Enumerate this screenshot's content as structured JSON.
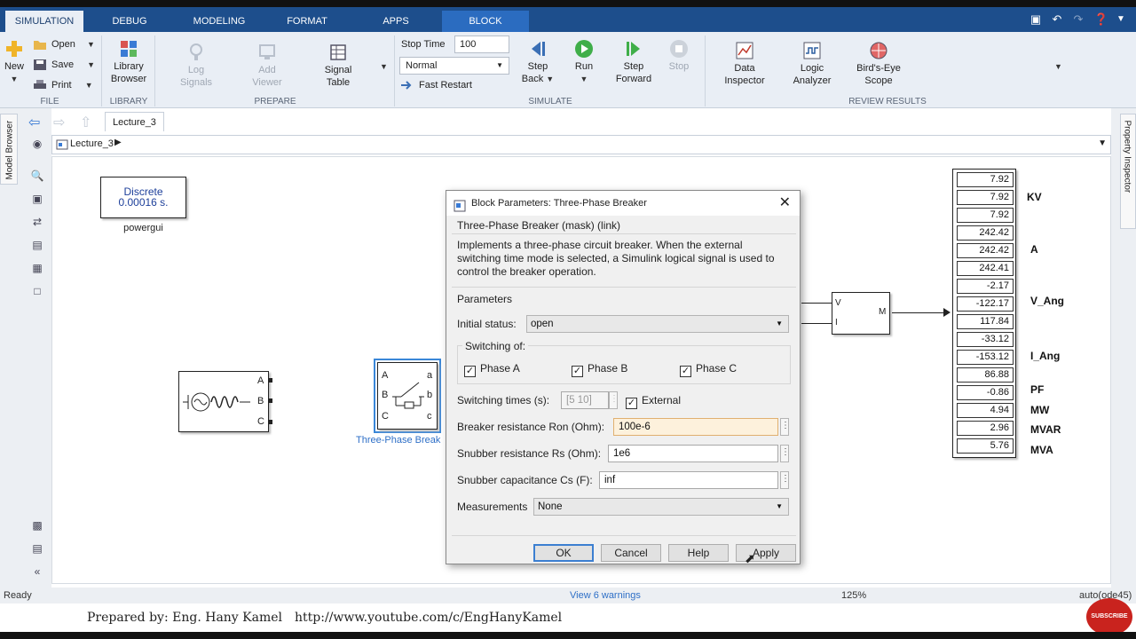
{
  "tabs": [
    {
      "label": "SIMULATION"
    },
    {
      "label": "DEBUG"
    },
    {
      "label": "MODELING"
    },
    {
      "label": "FORMAT"
    },
    {
      "label": "APPS"
    },
    {
      "label": "BLOCK"
    }
  ],
  "ribbon": {
    "file": {
      "new_label": "New",
      "open_label": "Open",
      "save_label": "Save",
      "print_label": "Print",
      "group_label": "FILE"
    },
    "library": {
      "browser_label_1": "Library",
      "browser_label_2": "Browser",
      "group_label": "LIBRARY"
    },
    "prepare": {
      "log_1": "Log",
      "log_2": "Signals",
      "add_1": "Add",
      "add_2": "Viewer",
      "signal_1": "Signal",
      "signal_2": "Table",
      "group_label": "PREPARE"
    },
    "simulate": {
      "stop_time_label": "Stop Time",
      "stop_time_value": "100",
      "mode_value": "Normal",
      "fast_restart_label": "Fast Restart",
      "step_back_1": "Step",
      "step_back_2": "Back",
      "run_label": "Run",
      "step_fwd_1": "Step",
      "step_fwd_2": "Forward",
      "stop_label": "Stop",
      "group_label": "SIMULATE"
    },
    "review": {
      "data_1": "Data",
      "data_2": "Inspector",
      "logic_1": "Logic",
      "logic_2": "Analyzer",
      "birds_1": "Bird's-Eye",
      "birds_2": "Scope",
      "group_label": "REVIEW RESULTS"
    }
  },
  "left_panel_tab": "Model Browser",
  "right_panel_tab": "Property Inspector",
  "nav": {
    "model_tab": "Lecture_3",
    "breadcrumb": "Lecture_3"
  },
  "canvas": {
    "powergui": {
      "line1": "Discrete",
      "line2": "0.00016 s.",
      "label": "powergui"
    },
    "source_ports": [
      "A",
      "B",
      "C"
    ],
    "breaker": {
      "ports_in": [
        "A",
        "B",
        "C"
      ],
      "ports_out": [
        "a",
        "b",
        "c"
      ],
      "label": "Three-Phase Break"
    },
    "vi_block": {
      "in_v": "V",
      "in_i": "I",
      "out_m": "M"
    },
    "display_values": [
      "7.92",
      "7.92",
      "7.92",
      "242.42",
      "242.42",
      "242.41",
      "-2.17",
      "-122.17",
      "117.84",
      "-33.12",
      "-153.12",
      "86.88",
      "-0.86",
      "4.94",
      "2.96",
      "5.76"
    ],
    "display_labels": {
      "kv": "KV",
      "a": "A",
      "v_ang": "V_Ang",
      "i_ang": "I_Ang",
      "pf": "PF",
      "mw": "MW",
      "mvar": "MVAR",
      "mva": "MVA"
    }
  },
  "dialog": {
    "title": "Block Parameters: Three-Phase Breaker",
    "mask_title": "Three-Phase Breaker (mask) (link)",
    "description": "Implements a three-phase circuit breaker. When the external switching time mode is selected, a Simulink logical signal is used to control the breaker operation.",
    "parameters_label": "Parameters",
    "initial_status_label": "Initial status:",
    "initial_status_value": "open",
    "switching_of_label": "Switching of:",
    "phase_a": "Phase A",
    "phase_b": "Phase B",
    "phase_c": "Phase C",
    "switching_times_label": "Switching times (s):",
    "switching_times_value": "[5  10]",
    "external_label": "External",
    "ron_label": "Breaker resistance Ron (Ohm):",
    "ron_value": "100e-6",
    "rs_label": "Snubber resistance Rs (Ohm):",
    "rs_value": "1e6",
    "cs_label": "Snubber capacitance Cs (F):",
    "cs_value": "inf",
    "measurements_label": "Measurements",
    "measurements_value": "None",
    "ok_label": "OK",
    "cancel_label": "Cancel",
    "help_label": "Help",
    "apply_label": "Apply"
  },
  "status": {
    "ready": "Ready",
    "warnings": "View 6 warnings",
    "zoom": "125%",
    "solver": "auto(ode45)"
  },
  "footer": {
    "prepared_by": "Prepared by: Eng. Hany Kamel",
    "url": "http://www.youtube.com/c/EngHanyKamel",
    "subscribe": "SUBSCRIBE"
  }
}
